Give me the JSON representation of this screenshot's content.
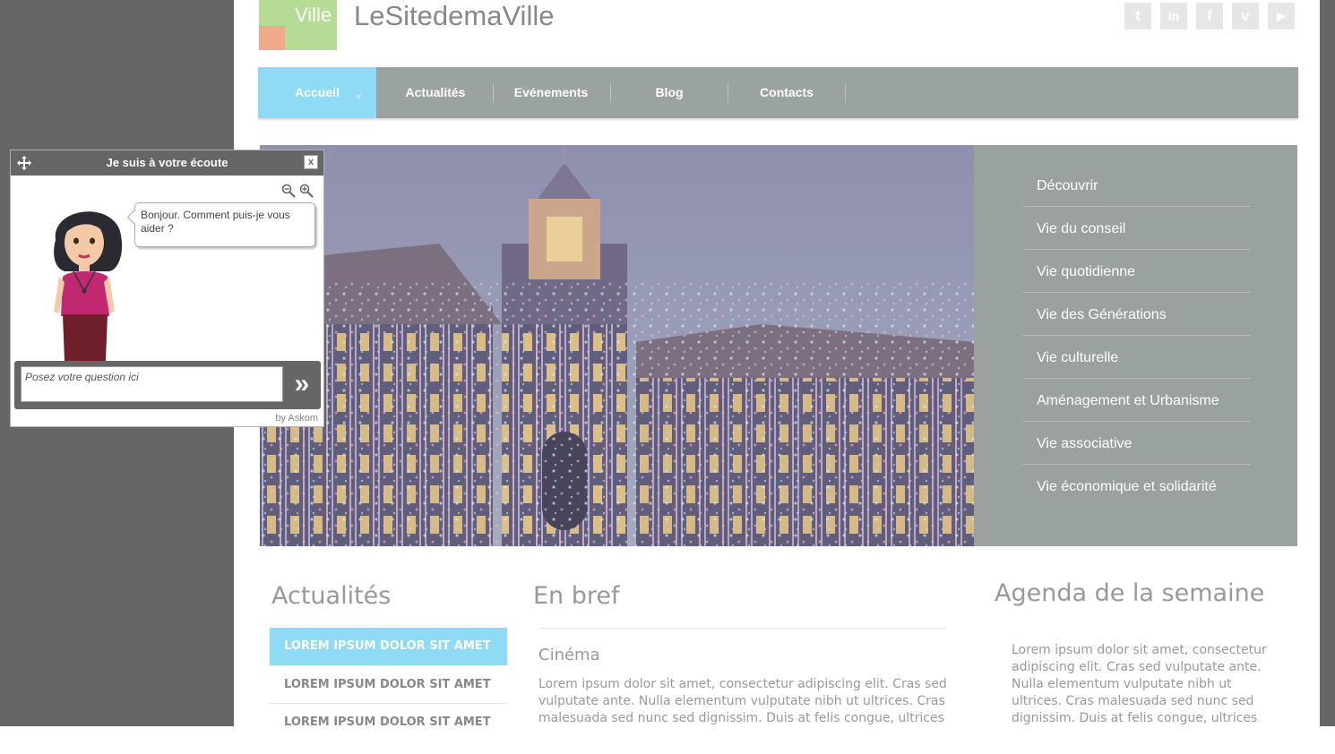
{
  "header": {
    "logo_text": "Ville",
    "site_title": "LeSitedemaVille",
    "social": [
      {
        "icon": "twitter-icon",
        "glyph": "t"
      },
      {
        "icon": "linkedin-icon",
        "glyph": "in"
      },
      {
        "icon": "facebook-icon",
        "glyph": "f"
      },
      {
        "icon": "vimeo-icon",
        "glyph": "v"
      },
      {
        "icon": "youtube-icon",
        "glyph": "▶"
      }
    ]
  },
  "nav": {
    "items": [
      {
        "label": "Accueil",
        "active": true
      },
      {
        "label": "Actualités"
      },
      {
        "label": "Evénements"
      },
      {
        "label": "Blog"
      },
      {
        "label": "Contacts"
      }
    ]
  },
  "hero_menu": {
    "items": [
      "Découvrir",
      "Vie du conseil",
      "Vie quotidienne",
      "Vie des Générations",
      "Vie culturelle",
      "Aménagement et Urbanisme",
      "Vie associative",
      "Vie économique et solidarité"
    ]
  },
  "actualites": {
    "title": "Actualités",
    "items": [
      "LOREM IPSUM DOLOR SIT AMET",
      "LOREM IPSUM DOLOR SIT AMET",
      "LOREM IPSUM DOLOR SIT AMET"
    ]
  },
  "en_bref": {
    "title": "En bref",
    "subtitle": "Cinéma",
    "text": "Lorem ipsum dolor sit amet, consectetur adipiscing elit. Cras sed vulputate ante. Nulla elementum vulputate nibh ut ultrices. Cras malesuada sed nunc sed dignissim. Duis at felis congue, ultrices augue"
  },
  "agenda": {
    "title": "Agenda de la semaine",
    "text": "Lorem ipsum dolor sit amet, consectetur adipiscing elit. Cras sed vulputate ante. Nulla elementum vulputate nibh ut ultrices. Cras malesuada sed nunc sed dignissim. Duis at felis congue, ultrices augue lacinia, tincidunt"
  },
  "chat": {
    "title": "Je suis à votre écoute",
    "close_label": "x",
    "greeting": "Bonjour. Comment puis-je vous aider ?",
    "input_placeholder": "Posez votre question ici",
    "send_label": "»",
    "credit": "by Askom"
  },
  "colors": {
    "accent": "#8fdaf4",
    "nav_bg": "#9aa3a1",
    "side_bg": "#666666"
  }
}
